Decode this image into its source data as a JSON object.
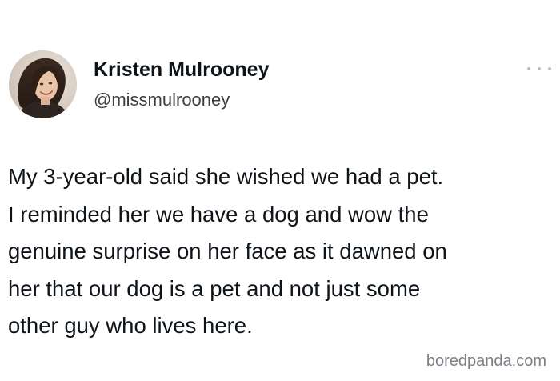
{
  "tweet": {
    "author": {
      "display_name": "Kristen Mulrooney",
      "handle": "@missmulrooney",
      "avatar_icon": "profile-photo"
    },
    "more_icon": "ellipsis-icon",
    "text_lines": [
      "My 3-year-old said she wished we had a pet.",
      "I reminded her we have a dog and wow the",
      "genuine surprise on her face as it dawned on",
      "her that our dog is a pet and not just some",
      "other guy who lives here."
    ]
  },
  "watermark": "boredpanda.com",
  "colors": {
    "background": "#ffffff",
    "text": "#0f1419",
    "secondary_text": "#3a3f44",
    "watermark": "#7a7f85"
  }
}
